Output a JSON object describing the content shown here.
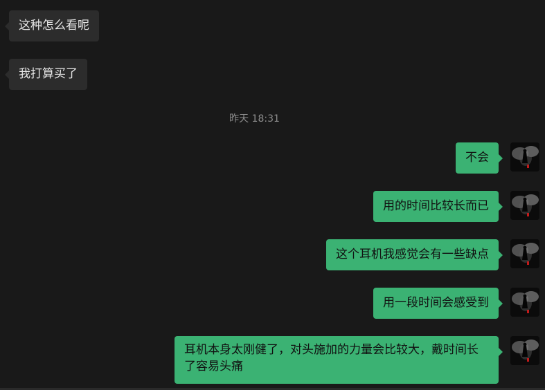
{
  "chat": {
    "incoming": [
      {
        "text": "这种怎么看呢"
      },
      {
        "text": "我打算买了"
      }
    ],
    "timestamp": "昨天 18:31",
    "outgoing": [
      {
        "text": "不会"
      },
      {
        "text": "用的时间比较长而已"
      },
      {
        "text": "这个耳机我感觉会有一些缺点"
      },
      {
        "text": "用一段时间会感受到"
      },
      {
        "text": "耳机本身太刚健了，对头施加的力量会比较大，戴时间长了容易头痛"
      }
    ],
    "avatar_icon": "dark-figure-avatar-icon",
    "colors": {
      "background": "#191919",
      "incoming_bubble": "#2c2c2c",
      "outgoing_bubble": "#3bb273",
      "timestamp": "#8d8d8d"
    }
  }
}
